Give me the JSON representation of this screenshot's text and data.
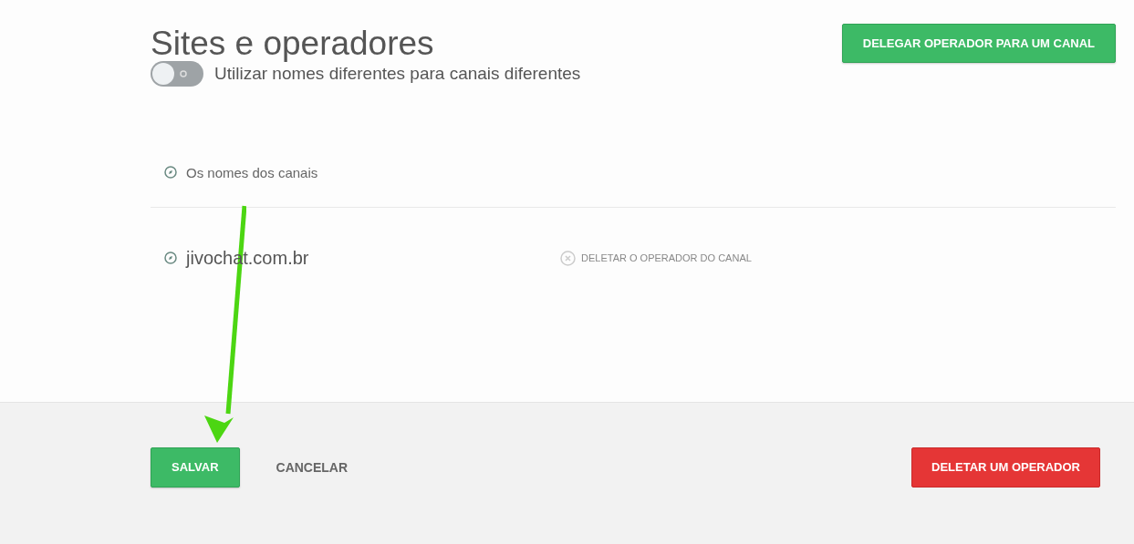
{
  "title": "Sites e operadores",
  "delegate_button": "DELEGAR OPERADOR PARA UM CANAL",
  "toggle": {
    "label": "Utilizar nomes diferentes para canais diferentes",
    "on": false
  },
  "header_row": {
    "label": "Os nomes dos canais"
  },
  "channels": [
    {
      "name": "jivochat.com.br",
      "action": "DELETAR O OPERADOR DO CANAL"
    }
  ],
  "footer": {
    "save": "SALVAR",
    "cancel": "CANCELAR",
    "delete": "DELETAR UM OPERADOR"
  }
}
